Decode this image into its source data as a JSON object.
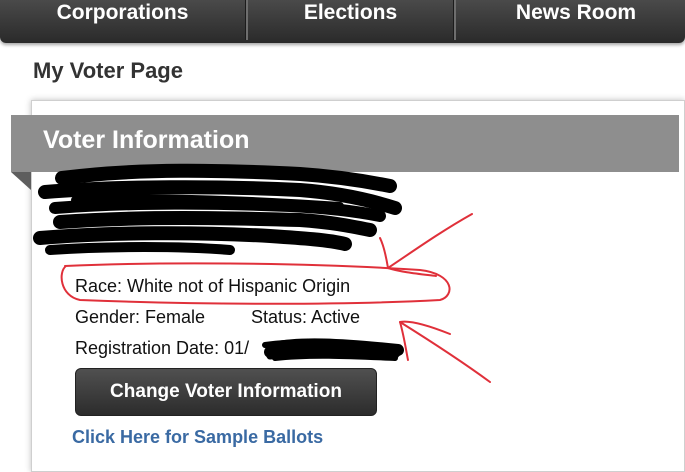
{
  "nav": {
    "items": [
      {
        "label": "Corporations"
      },
      {
        "label": "Elections"
      },
      {
        "label": "News Room"
      }
    ]
  },
  "page": {
    "title": "My Voter Page"
  },
  "voter_info": {
    "heading": "Voter Information",
    "race": "Race: White not of Hispanic Origin",
    "gender": "Gender: Female",
    "status": "Status: Active",
    "registration_date_visible": "Registration Date: 01/"
  },
  "actions": {
    "change_button": "Change Voter Information",
    "sample_ballots_link": "Click Here for Sample Ballots"
  },
  "colors": {
    "nav_bg": "#3a3a3a",
    "banner_bg": "#8e8e8e",
    "link": "#3a6aa3",
    "annotation": "#e0303a",
    "redaction": "#000000"
  }
}
